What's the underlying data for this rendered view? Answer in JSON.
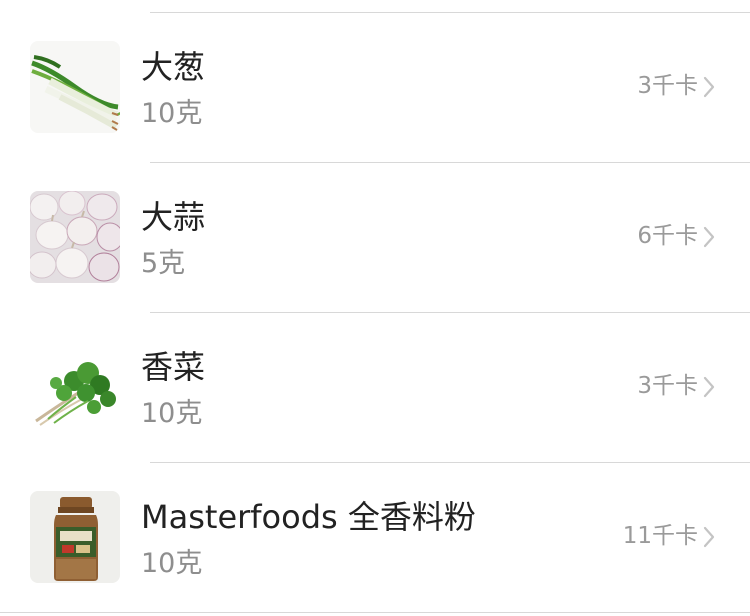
{
  "ingredients": [
    {
      "name": "大葱",
      "amount": "10克",
      "calories": "3千卡",
      "image": "scallion"
    },
    {
      "name": "大蒜",
      "amount": "5克",
      "calories": "6千卡",
      "image": "garlic"
    },
    {
      "name": "香菜",
      "amount": "10克",
      "calories": "3千卡",
      "image": "coriander"
    },
    {
      "name": "Masterfoods 全香料粉",
      "amount": "10克",
      "calories": "11千卡",
      "image": "spice-jar"
    }
  ],
  "colors": {
    "name": "#222222",
    "amount": "#8e8e8e",
    "calories": "#9a9a9a",
    "divider": "#d8d8d8"
  }
}
